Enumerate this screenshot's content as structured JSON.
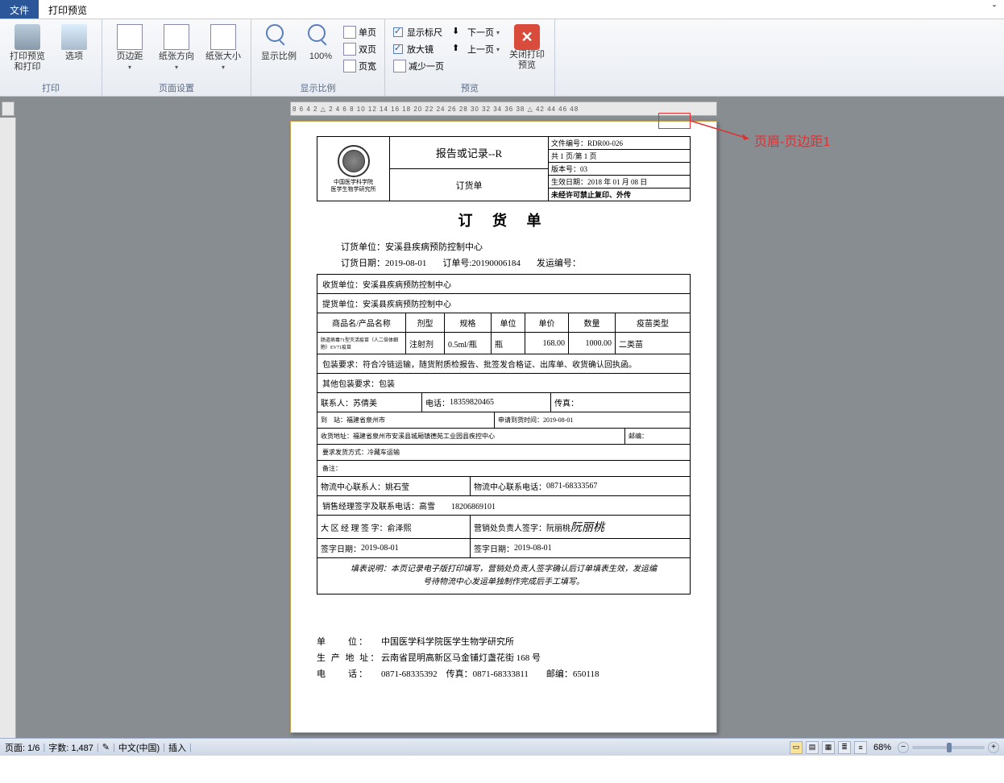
{
  "tabs": {
    "file": "文件",
    "preview": "打印预览"
  },
  "ribbon": {
    "g_print": "打印",
    "g_page": "页面设置",
    "g_zoom": "显示比例",
    "g_preview": "预览",
    "print_preview": "打印预览和打印",
    "options": "选项",
    "margins": "页边距",
    "orientation": "纸张方向",
    "size": "纸张大小",
    "zoom": "显示比例",
    "zoom_100": "100%",
    "single_page": "单页",
    "two_page": "双页",
    "page_width": "页宽",
    "show_ruler": "显示标尺",
    "magnifier": "放大镜",
    "one_less": "减少一页",
    "next_page": "下一页",
    "prev_page": "上一页",
    "close": "关闭打印预览"
  },
  "ruler": "8   6   4   2   △   2   4   6   8   10   12   14   16   18   20   22   24   26   28   30   32   34   36   38   △   42   44   46   48",
  "annotation": "页眉-页边距1",
  "doc": {
    "header": {
      "logo_line1": "中国医学科学院",
      "logo_line2": "医学生物学研究所",
      "mid_top": "报告或记录--R",
      "mid_bot": "订货单",
      "r1": "文件编号：RDR00-026",
      "r2": "共 1 页/第 1 页",
      "r3": "版本号：03",
      "r4": "生效日期：2018 年 01 月 08 日",
      "r5": "未经许可禁止复印、外传"
    },
    "title": "订 货 单",
    "order_unit_label": "订货单位：",
    "order_unit": "安溪县疾病预防控制中心",
    "order_date_label": "订货日期：",
    "order_date": "2019-08-01",
    "order_no_label": "订单号:",
    "order_no": "20190006184",
    "ship_no_label": "发运编号：",
    "recv_unit_label": "收货单位：",
    "recv_unit": "安溪县疾病预防控制中心",
    "pick_unit_label": "提货单位：",
    "pick_unit": "安溪县疾病预防控制中心",
    "cols": {
      "name": "商品名/产品名称",
      "form": "剂型",
      "spec": "规格",
      "unit": "单位",
      "price": "单价",
      "qty": "数量",
      "type": "疫苗类型"
    },
    "row1": {
      "name": "肠道病毒71型灭活疫苗（人二倍体细胞）EV71疫苗",
      "form": "注射剂",
      "spec": "0.5ml/瓶",
      "unit": "瓶",
      "price": "168.00",
      "qty": "1000.00",
      "type": "二类苗"
    },
    "pack_req": "包装要求：符合冷链运输，随货附质检报告、批签发合格证、出库单、收货确认回执函。",
    "other_pack": "其他包装要求：包装",
    "contact_label": "联系人：",
    "contact": "苏倩美",
    "phone_label": "电话：",
    "phone": "18359820465",
    "fax_label": "传真：",
    "dest_label": "到　站：",
    "dest": "福建省泉州市",
    "req_time_label": "申请到货时间：",
    "req_time": "2019-08-01",
    "recv_addr_label": "收货地址：",
    "recv_addr": "福建省泉州市安溪县城厢镇德苑工业园县疾控中心",
    "post_label": "邮编：",
    "ship_method_label": "要求发货方式：",
    "ship_method": "冷藏车运输",
    "remark_label": "备注：",
    "log_contact_label": "物流中心联系人：",
    "log_contact": "姚石莹",
    "log_phone_label": "物流中心联系电话：",
    "log_phone": "0871-68333567",
    "sales_mgr_label": "销售经理签字及联系电话：",
    "sales_mgr": "高雪　　18206869101",
    "region_mgr_label": "大 区 经 理 签 字：",
    "region_mgr": "俞泽熙",
    "sales_head_label": "营销处负责人签字：",
    "sales_head": "阮丽桃",
    "sales_head_sig": "阮丽桃",
    "sign_date1_label": "签字日期：",
    "sign_date1": "2019-08-01",
    "sign_date2_label": "签字日期：",
    "sign_date2": "2019-08-01",
    "note1": "填表说明：本页记录电子版打印填写，营销处负责人签字确认后订单填表生效，发运编",
    "note2": "号待物流中心发运单独制作完成后手工填写。",
    "f_unit_label": "单　　位：",
    "f_unit": "中国医学科学院医学生物学研究所",
    "f_addr_label": "生 产 地 址：",
    "f_addr": "云南省昆明高新区马金铺灯盏花街 168 号",
    "f_tel_label": "电　　话：",
    "f_tel": "0871-68335392　传真：0871-68333811　　邮编：650118"
  },
  "status": {
    "page": "页面: 1/6",
    "words": "字数: 1,487",
    "lang": "中文(中国)",
    "mode": "插入",
    "zoom": "68%"
  }
}
